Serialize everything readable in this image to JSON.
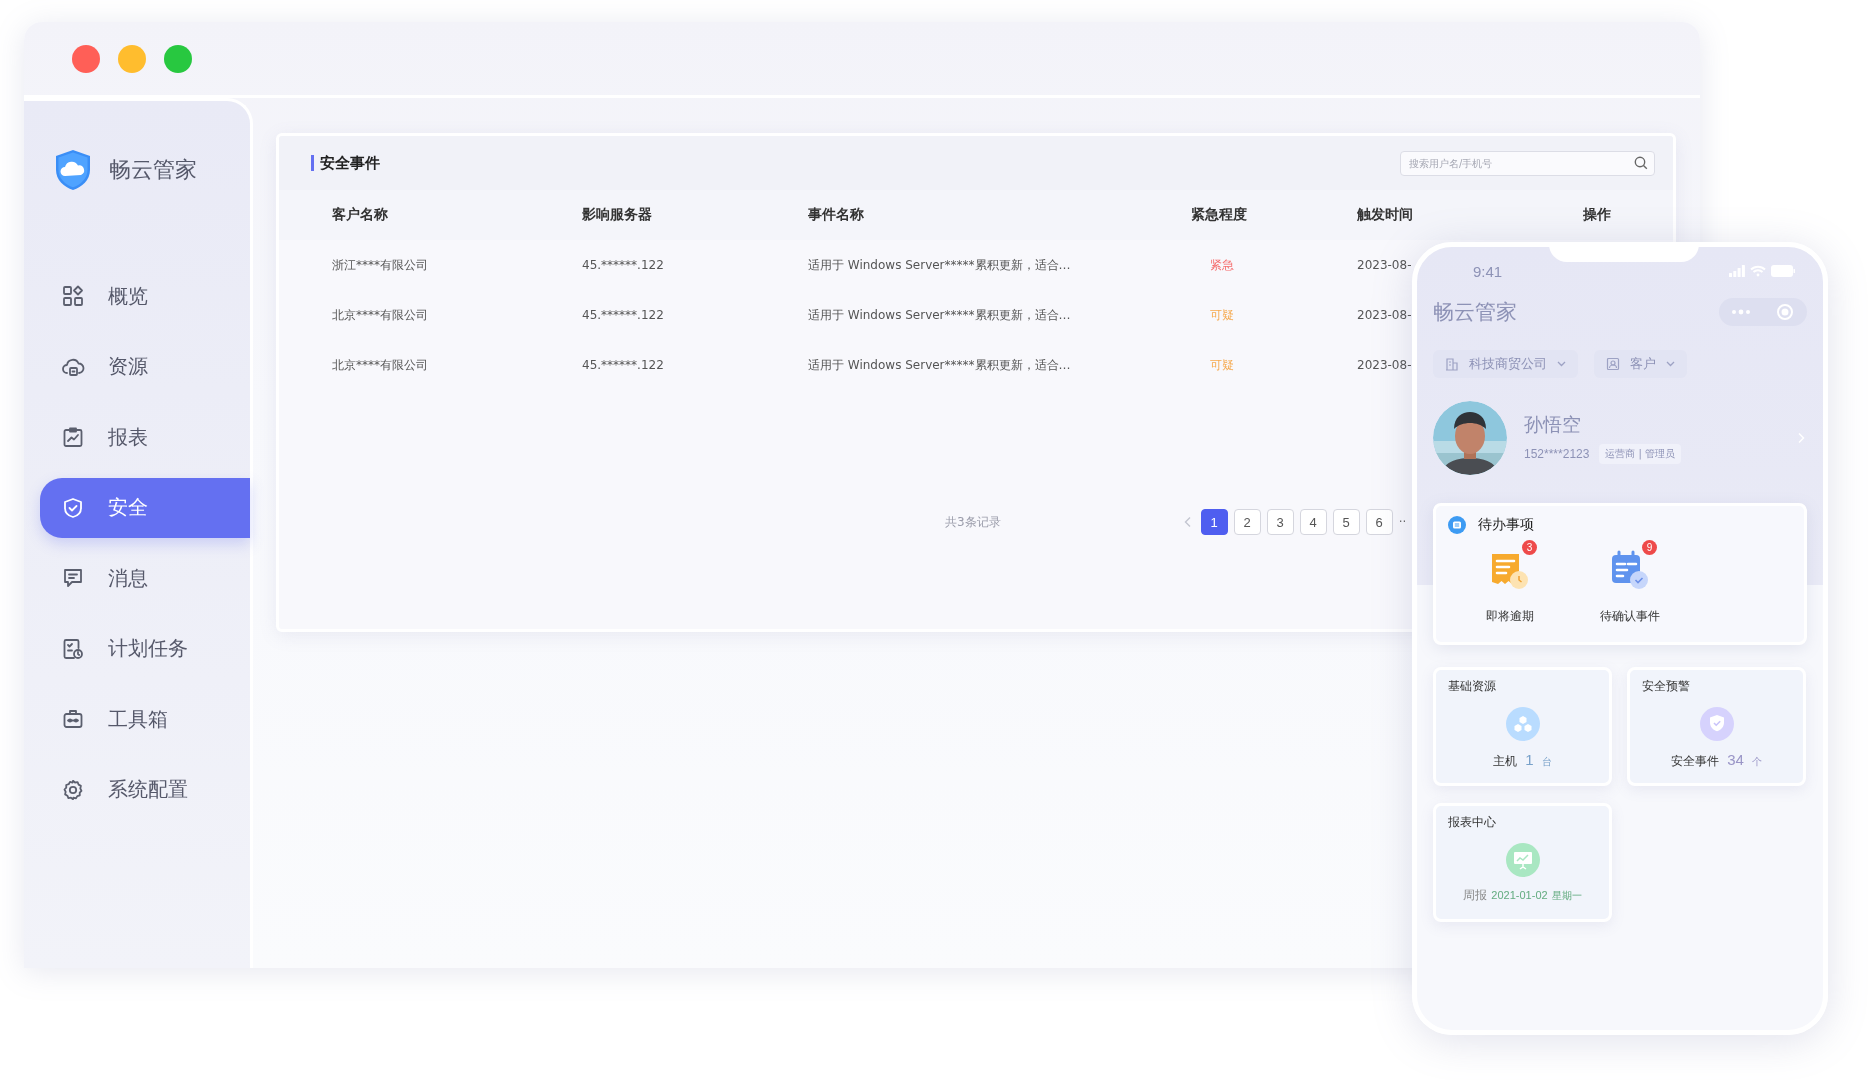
{
  "window": {
    "controls": [
      {
        "color": "#ff5f57"
      },
      {
        "color": "#ffbd2e"
      },
      {
        "color": "#28c840"
      }
    ]
  },
  "sidebar": {
    "brand": "畅云管家",
    "items": [
      {
        "label": "概览",
        "selected": false
      },
      {
        "label": "资源",
        "selected": false
      },
      {
        "label": "报表",
        "selected": false
      },
      {
        "label": "安全",
        "selected": true
      },
      {
        "label": "消息",
        "selected": false
      },
      {
        "label": "计划任务",
        "selected": false
      },
      {
        "label": "工具箱",
        "selected": false
      },
      {
        "label": "系统配置",
        "selected": false
      }
    ]
  },
  "panel": {
    "title": "安全事件",
    "search": {
      "placeholder": "搜索用户名/手机号"
    },
    "table": {
      "columns": [
        "客户名称",
        "影响服务器",
        "事件名称",
        "紧急程度",
        "触发时间",
        "操作"
      ],
      "rows": [
        {
          "customer": "浙江****有限公司",
          "server": "45.******.122",
          "event": "适用于 Windows Server*****累积更新，适合…",
          "urgency": "紧急",
          "color": "#f56c6c",
          "time": "2023-08-"
        },
        {
          "customer": "北京****有限公司",
          "server": "45.******.122",
          "event": "适用于 Windows Server*****累积更新，适合…",
          "urgency": "可疑",
          "color": "#f5a94e",
          "time": "2023-08-"
        },
        {
          "customer": "北京****有限公司",
          "server": "45.******.122",
          "event": "适用于 Windows Server*****累积更新，适合…",
          "urgency": "可疑",
          "color": "#f5a94e",
          "time": "2023-08-"
        }
      ]
    },
    "footer": {
      "total": "共3条记录",
      "pages": [
        {
          "label": "1",
          "selected": true
        },
        {
          "label": "2",
          "selected": false
        },
        {
          "label": "3",
          "selected": false
        },
        {
          "label": "4",
          "selected": false
        },
        {
          "label": "5",
          "selected": false
        },
        {
          "label": "6",
          "selected": false
        }
      ],
      "more": "··"
    }
  },
  "phone": {
    "time": "9:41",
    "title": "畅云管家",
    "filters": [
      {
        "label": "科技商贸公司"
      },
      {
        "label": "客户"
      }
    ],
    "user": {
      "name": "孙悟空",
      "phone": "152****2123",
      "role": "运营商 | 管理员"
    },
    "todo": {
      "title": "待办事项",
      "items": [
        {
          "label": "即将逾期",
          "count": "3"
        },
        {
          "label": "待确认事件",
          "count": "9"
        }
      ]
    },
    "cards": [
      {
        "title": "基础资源",
        "color": "#b9dcff",
        "label": "主机",
        "value": "1",
        "unit": "台"
      },
      {
        "title": "安全预警",
        "color": "#d6d2fd",
        "label": "安全事件",
        "value": "34",
        "unit": "个"
      },
      {
        "title": "报表中心",
        "color": "#a9e7c2",
        "label": "周报",
        "value": "2021-01-02",
        "unit": "星期一"
      }
    ]
  }
}
